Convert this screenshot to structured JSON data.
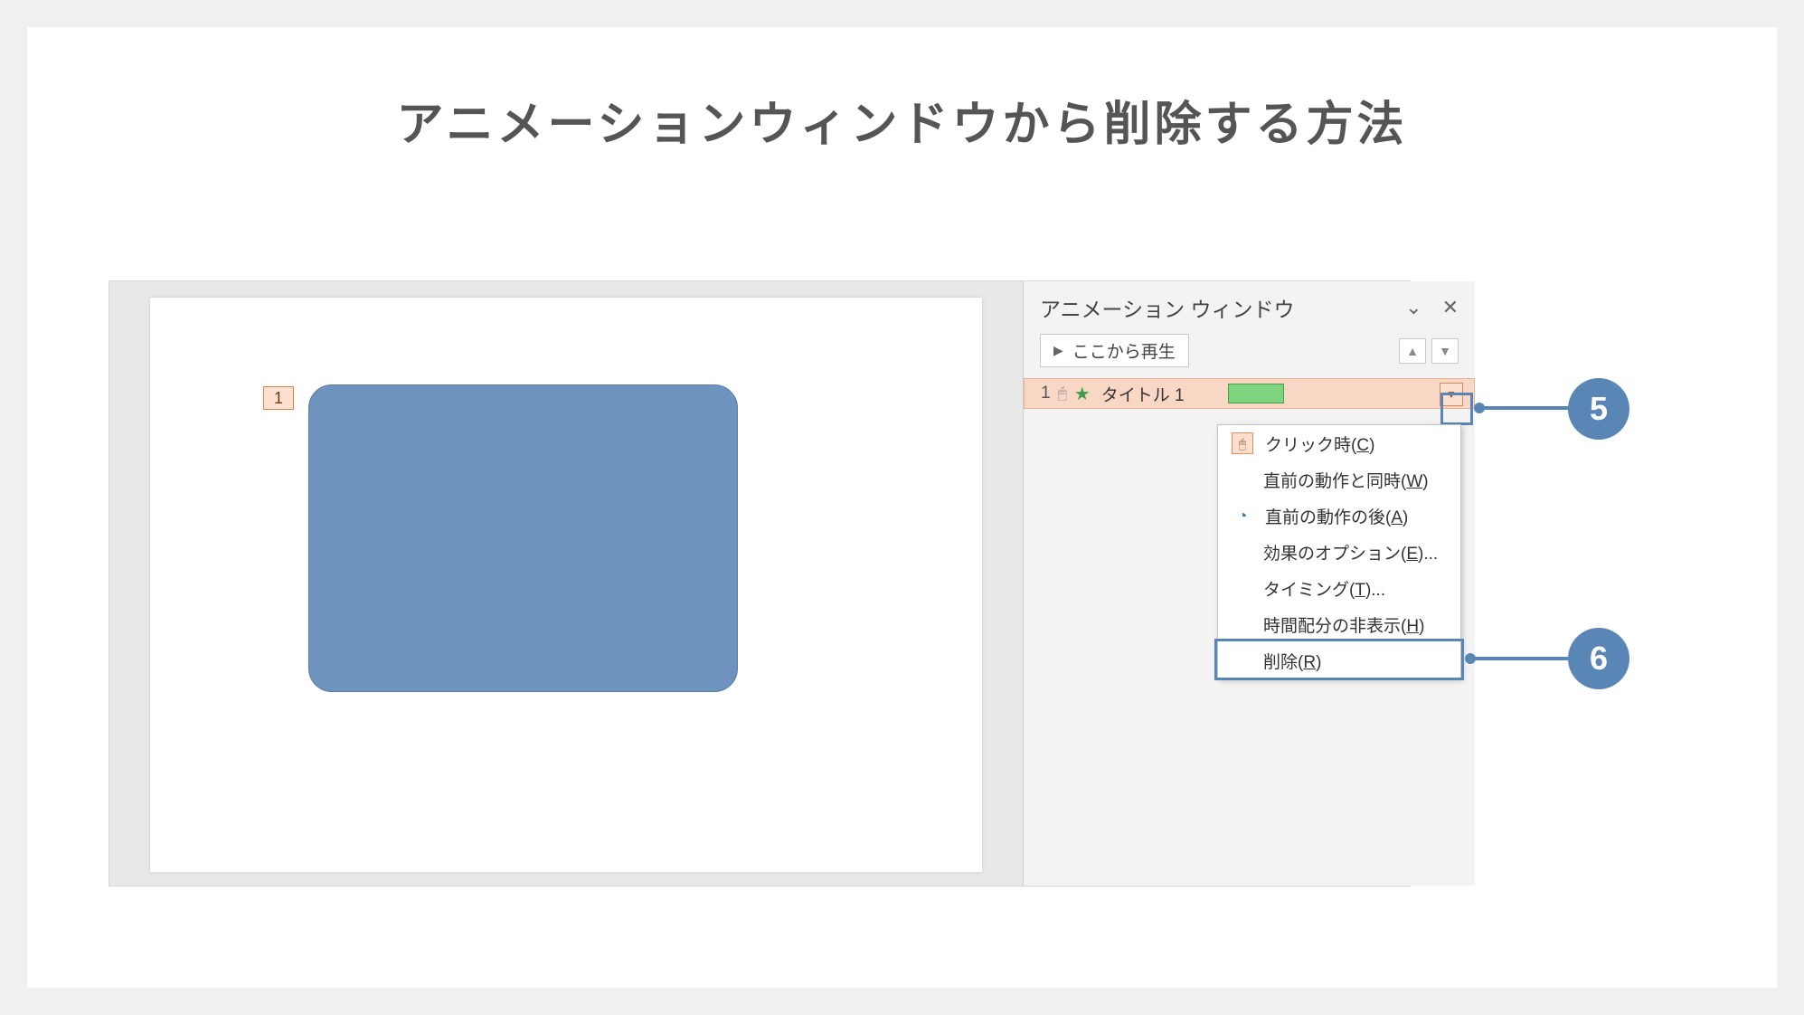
{
  "page_title": "アニメーションウィンドウから削除する方法",
  "slide": {
    "anim_tag": "1"
  },
  "animation_pane": {
    "title": "アニメーション ウィンドウ",
    "play_button": "ここから再生",
    "item": {
      "number": "1",
      "name": "タイトル 1"
    }
  },
  "context_menu": {
    "on_click": "クリック時(",
    "on_click_key": "C",
    "on_click_end": ")",
    "with_prev": "直前の動作と同時(",
    "with_prev_key": "W",
    "with_prev_end": ")",
    "after_prev": "直前の動作の後(",
    "after_prev_key": "A",
    "after_prev_end": ")",
    "effect_opts": "効果のオプション(",
    "effect_opts_key": "E",
    "effect_opts_end": ")...",
    "timing": "タイミング(",
    "timing_key": "T",
    "timing_end": ")...",
    "hide_timeline": "時間配分の非表示(",
    "hide_timeline_key": "H",
    "hide_timeline_end": ")",
    "delete": "削除(",
    "delete_key": "R",
    "delete_end": ")"
  },
  "callouts": {
    "step5": "5",
    "step6": "6"
  }
}
